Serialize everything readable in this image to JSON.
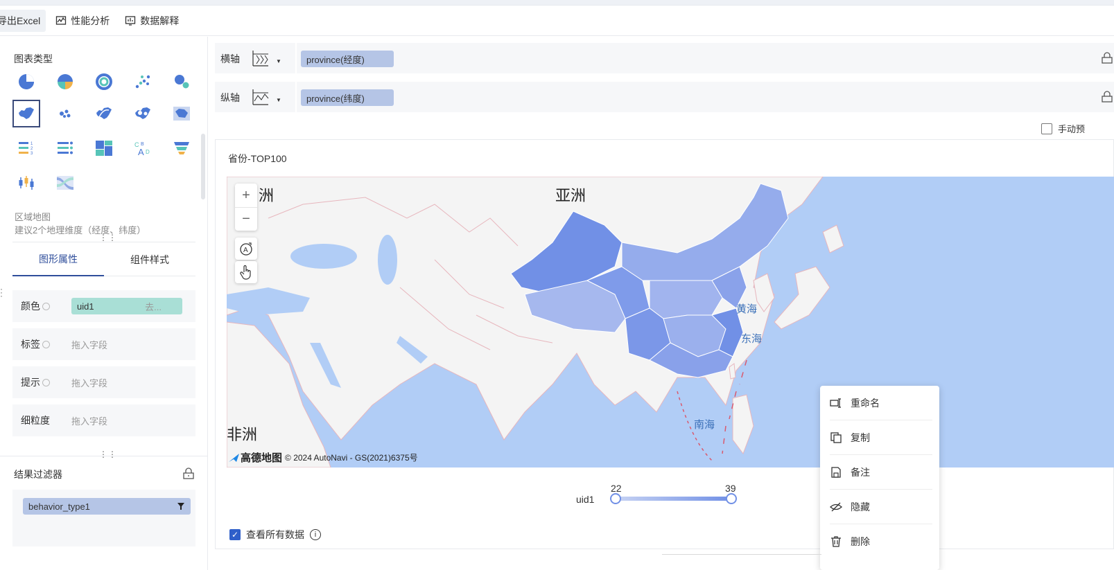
{
  "toolbar": {
    "export_label": "导出Excel",
    "perf_label": "性能分析",
    "explain_label": "数据解释"
  },
  "left_panel": {
    "chart_type_title": "图表类型",
    "selected_chart_name": "区域地图",
    "selected_chart_hint": "建议2个地理维度（经度、纬度）",
    "chart_icons": [
      "pie-chart",
      "donut-chart",
      "ring-chart",
      "scatter-chart",
      "bubble-chart",
      "region-map",
      "point-map",
      "flow-map",
      "heat-map",
      "area-map",
      "ranking-list",
      "progress-list",
      "treemap",
      "word-cloud",
      "funnel-chart",
      "candlestick-chart",
      "sankey-chart"
    ],
    "tabs": [
      "图形属性",
      "组件样式"
    ],
    "props": [
      {
        "label": "颜色",
        "value": "uid1",
        "remove": "去..."
      },
      {
        "label": "标签",
        "value": "拖入字段"
      },
      {
        "label": "提示",
        "value": "拖入字段"
      },
      {
        "label": "细粒度",
        "value": "拖入字段"
      }
    ],
    "filter_title": "结果过滤器",
    "filter_chip": "behavior_type1"
  },
  "axes": {
    "x": {
      "label": "横轴",
      "field": "province(经度)"
    },
    "y": {
      "label": "纵轴",
      "field": "province(纬度)"
    }
  },
  "manual_preview": "手动预",
  "chart": {
    "title": "省份-TOP100",
    "map_labels": {
      "europe": "洲",
      "asia": "亚洲",
      "africa": "非洲"
    },
    "sea_labels": {
      "yellow_sea": "黄海",
      "east_sea": "东海",
      "south_sea": "南海"
    },
    "attribution_brand": "高德地图",
    "attribution_text": "© 2024 AutoNavi - GS(2021)6375号",
    "legend": {
      "field": "uid1",
      "min": "22",
      "max": "39"
    },
    "view_all": "查看所有数据"
  },
  "context_menu": [
    "重命名",
    "复制",
    "备注",
    "隐藏",
    "删除"
  ],
  "colors": {
    "accent": "#2f4e9b",
    "map_sea": "#b1cdf6",
    "field_chip": "#b5c5e6",
    "color_chip": "#a9dfd6",
    "map_high": "#7190e6"
  }
}
